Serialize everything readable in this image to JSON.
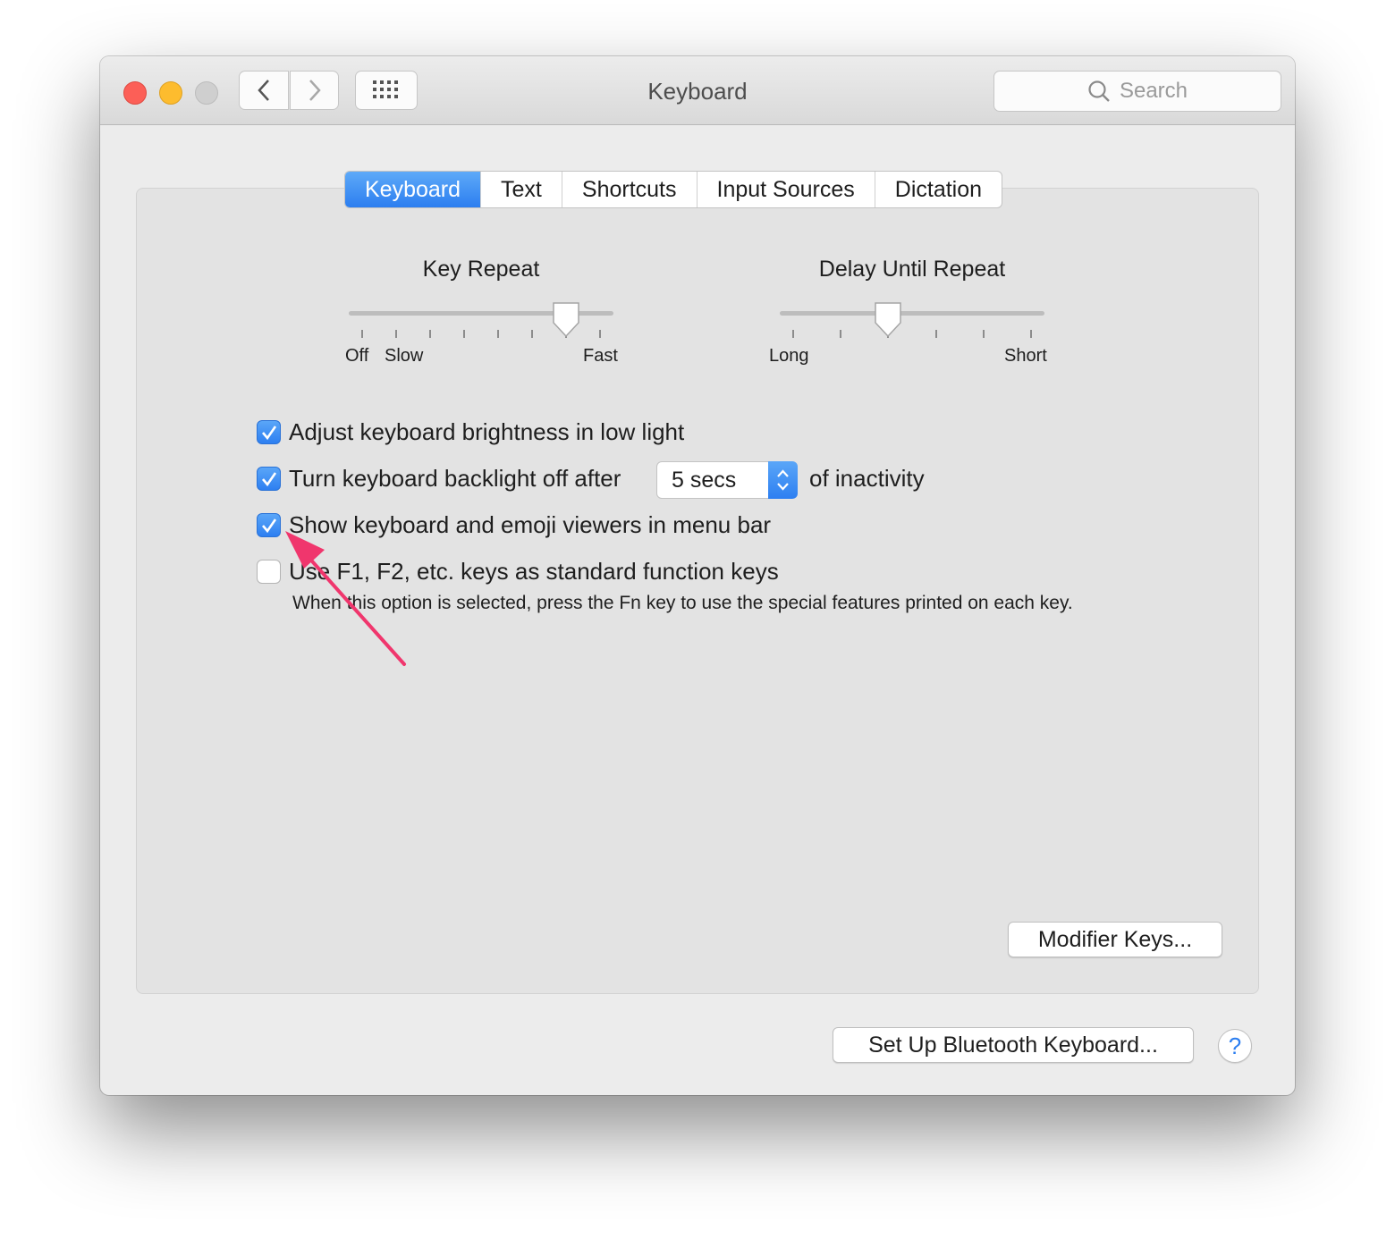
{
  "window": {
    "title": "Keyboard",
    "search_placeholder": "Search"
  },
  "toolbar": {
    "back_icon": "chevron-left-icon",
    "forward_icon": "chevron-right-icon",
    "grid_icon": "show-all-grid-icon"
  },
  "tabs": [
    {
      "label": "Keyboard",
      "active": true
    },
    {
      "label": "Text",
      "active": false
    },
    {
      "label": "Shortcuts",
      "active": false
    },
    {
      "label": "Input Sources",
      "active": false
    },
    {
      "label": "Dictation",
      "active": false
    }
  ],
  "key_repeat": {
    "title": "Key Repeat",
    "labels": {
      "off": "Off",
      "slow": "Slow",
      "fast": "Fast"
    },
    "tick_count": 8,
    "position_index": 6
  },
  "delay_until_repeat": {
    "title": "Delay Until Repeat",
    "labels": {
      "long": "Long",
      "short": "Short"
    },
    "tick_count": 6,
    "position_index": 2
  },
  "options": {
    "adjust_brightness": {
      "label": "Adjust keyboard brightness in low light",
      "checked": true
    },
    "backlight_off": {
      "label": "Turn keyboard backlight off after",
      "suffix": "of inactivity",
      "checked": true,
      "value": "5 secs"
    },
    "show_viewers": {
      "label": "Show keyboard and emoji viewers in menu bar",
      "checked": true
    },
    "function_keys": {
      "label": "Use F1, F2, etc. keys as standard function keys",
      "checked": false,
      "note": "When this option is selected, press the Fn key to use the special features printed on each key."
    }
  },
  "buttons": {
    "modifier_keys": "Modifier Keys...",
    "bluetooth": "Set Up Bluetooth Keyboard...",
    "help": "?"
  },
  "colors": {
    "accent": "#2c7ef0",
    "annotation_arrow": "#f0366d"
  }
}
